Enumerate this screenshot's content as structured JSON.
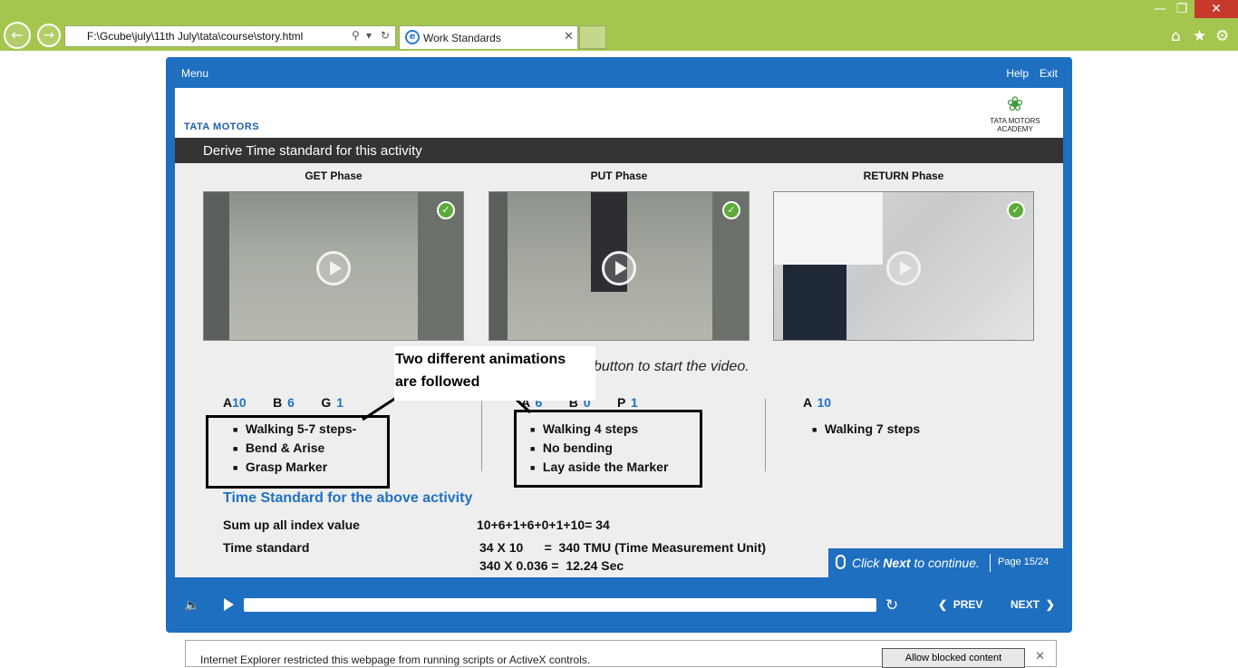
{
  "browser": {
    "address": "F:\\Gcube\\july\\11th July\\tata\\course\\story.html",
    "tab_title": "Work Standards"
  },
  "player": {
    "menu": "Menu",
    "help": "Help",
    "exit": "Exit",
    "tata_logo": "TATA MOTORS",
    "academy_logo": "TATA MOTORS ACADEMY",
    "slide_title": "Derive Time standard for this activity",
    "phases": [
      {
        "label": "GET Phase"
      },
      {
        "label": "PUT Phase"
      },
      {
        "label": "RETURN Phase"
      }
    ],
    "instruction": "button to start the video.",
    "callout": [
      "Two different animations",
      "are followed"
    ],
    "codes": {
      "get": [
        {
          "letter": "A",
          "value": "10"
        },
        {
          "letter": "B",
          "value": "6"
        },
        {
          "letter": "G",
          "value": "1"
        }
      ],
      "put": [
        {
          "letter": "A",
          "value": "6"
        },
        {
          "letter": "B",
          "value": "0"
        },
        {
          "letter": "P",
          "value": "1"
        }
      ],
      "return": [
        {
          "letter": "A",
          "value": "10"
        }
      ]
    },
    "steps": {
      "get": [
        "Walking 5-7 steps-",
        "Bend & Arise",
        "Grasp Marker"
      ],
      "put": [
        "Walking 4 steps",
        "No bending",
        "Lay aside the Marker"
      ],
      "return": [
        "Walking 7 steps"
      ]
    },
    "time_standard": {
      "heading": "Time Standard for the above activity",
      "sum_label": "Sum up all index value",
      "sum_value": "10+6+1+6+0+1+10= 34",
      "ts_label": "Time standard",
      "ts_line1": "34 X 10      =  340 TMU (Time Measurement Unit)",
      "ts_line2": "340 X 0.036 =  12.24 Sec"
    },
    "continue": {
      "click": "Click ",
      "next_word": "Next",
      "rest": " to continue.",
      "page_label": "Page  15/24"
    },
    "controls": {
      "prev": "PREV",
      "next": "NEXT"
    }
  },
  "notification": {
    "text": "Internet Explorer restricted this webpage from running scripts or ActiveX controls.",
    "allow": "Allow blocked content"
  }
}
